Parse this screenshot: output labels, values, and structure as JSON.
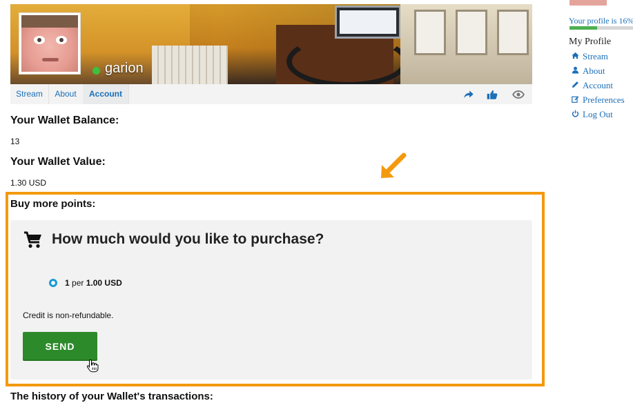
{
  "profile": {
    "username": "garion",
    "online_status": "online"
  },
  "tabs": {
    "stream": "Stream",
    "about": "About",
    "account": "Account"
  },
  "tab_icons": [
    "share-icon",
    "like-icon",
    "eye-icon"
  ],
  "wallet": {
    "balance_heading": "Your Wallet Balance:",
    "balance_value": "13",
    "value_heading": "Your Wallet Value:",
    "value_amount": "1.30 USD"
  },
  "buy": {
    "heading": "Buy more points:",
    "question": "How much would you like to purchase?",
    "option": {
      "points": "1",
      "per": "per",
      "price": "1.00 USD",
      "selected": true
    },
    "note": "Credit is non-refundable.",
    "send_label": "SEND"
  },
  "history_heading": "The history of your Wallet's transactions:",
  "sidebar": {
    "profile_completion": "Your profile is 16%",
    "profile_progress": 0.16,
    "my_profile": "My Profile",
    "links": [
      {
        "icon": "home-icon",
        "label": "Stream"
      },
      {
        "icon": "user-icon",
        "label": "About"
      },
      {
        "icon": "pencil-icon",
        "label": "Account"
      },
      {
        "icon": "edit-icon",
        "label": "Preferences"
      },
      {
        "icon": "power-icon",
        "label": "Log Out"
      }
    ]
  },
  "colors": {
    "highlight_orange": "#f4990d",
    "send_green": "#2d8a2a",
    "link_blue": "#1c6fb8",
    "online_green": "#3fbf3f"
  }
}
